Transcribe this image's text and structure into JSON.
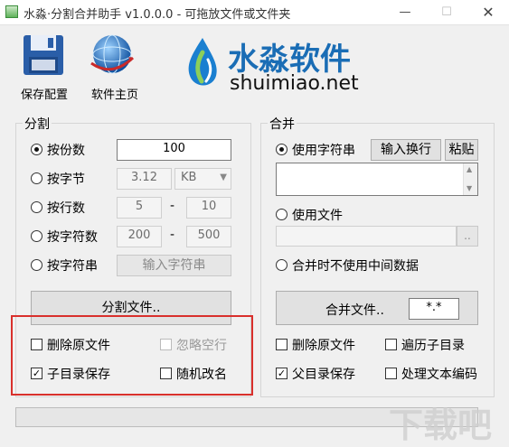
{
  "window": {
    "title": "水淼·分割合并助手 v1.0.0.0 - 可拖放文件或文件夹"
  },
  "toolbar": {
    "save_label": "保存配置",
    "home_label": "软件主页"
  },
  "brand": {
    "name": "水淼软件",
    "url": "shuimiao.net"
  },
  "split": {
    "group_label": "分割",
    "by_parts_label": "按份数",
    "by_parts_value": "100",
    "by_bytes_label": "按字节",
    "by_bytes_value": "3.12",
    "by_bytes_unit": "KB",
    "by_lines_label": "按行数",
    "by_lines_from": "5",
    "by_lines_to": "10",
    "by_chars_label": "按字符数",
    "by_chars_from": "200",
    "by_chars_to": "500",
    "by_string_label": "按字符串",
    "by_string_button": "输入字符串",
    "dash": "-",
    "split_button": "分割文件..",
    "delete_original_label": "删除原文件",
    "ignore_blank_label": "忽略空行",
    "subdir_save_label": "子目录保存",
    "random_rename_label": "随机改名"
  },
  "merge": {
    "group_label": "合并",
    "use_string_label": "使用字符串",
    "input_newline_button": "输入换行",
    "paste_button": "粘贴",
    "use_file_label": "使用文件",
    "browse_button": "..",
    "no_temp_label": "合并时不使用中间数据",
    "merge_button": "合并文件..",
    "pattern_value": "*.*",
    "delete_original_label": "删除原文件",
    "traverse_subdir_label": "遍历子目录",
    "parent_dir_save_label": "父目录保存",
    "text_encoding_label": "处理文本编码"
  },
  "watermark": "下载吧",
  "colors": {
    "brand_blue": "#1a6db5",
    "accent_red": "#d9302c"
  }
}
